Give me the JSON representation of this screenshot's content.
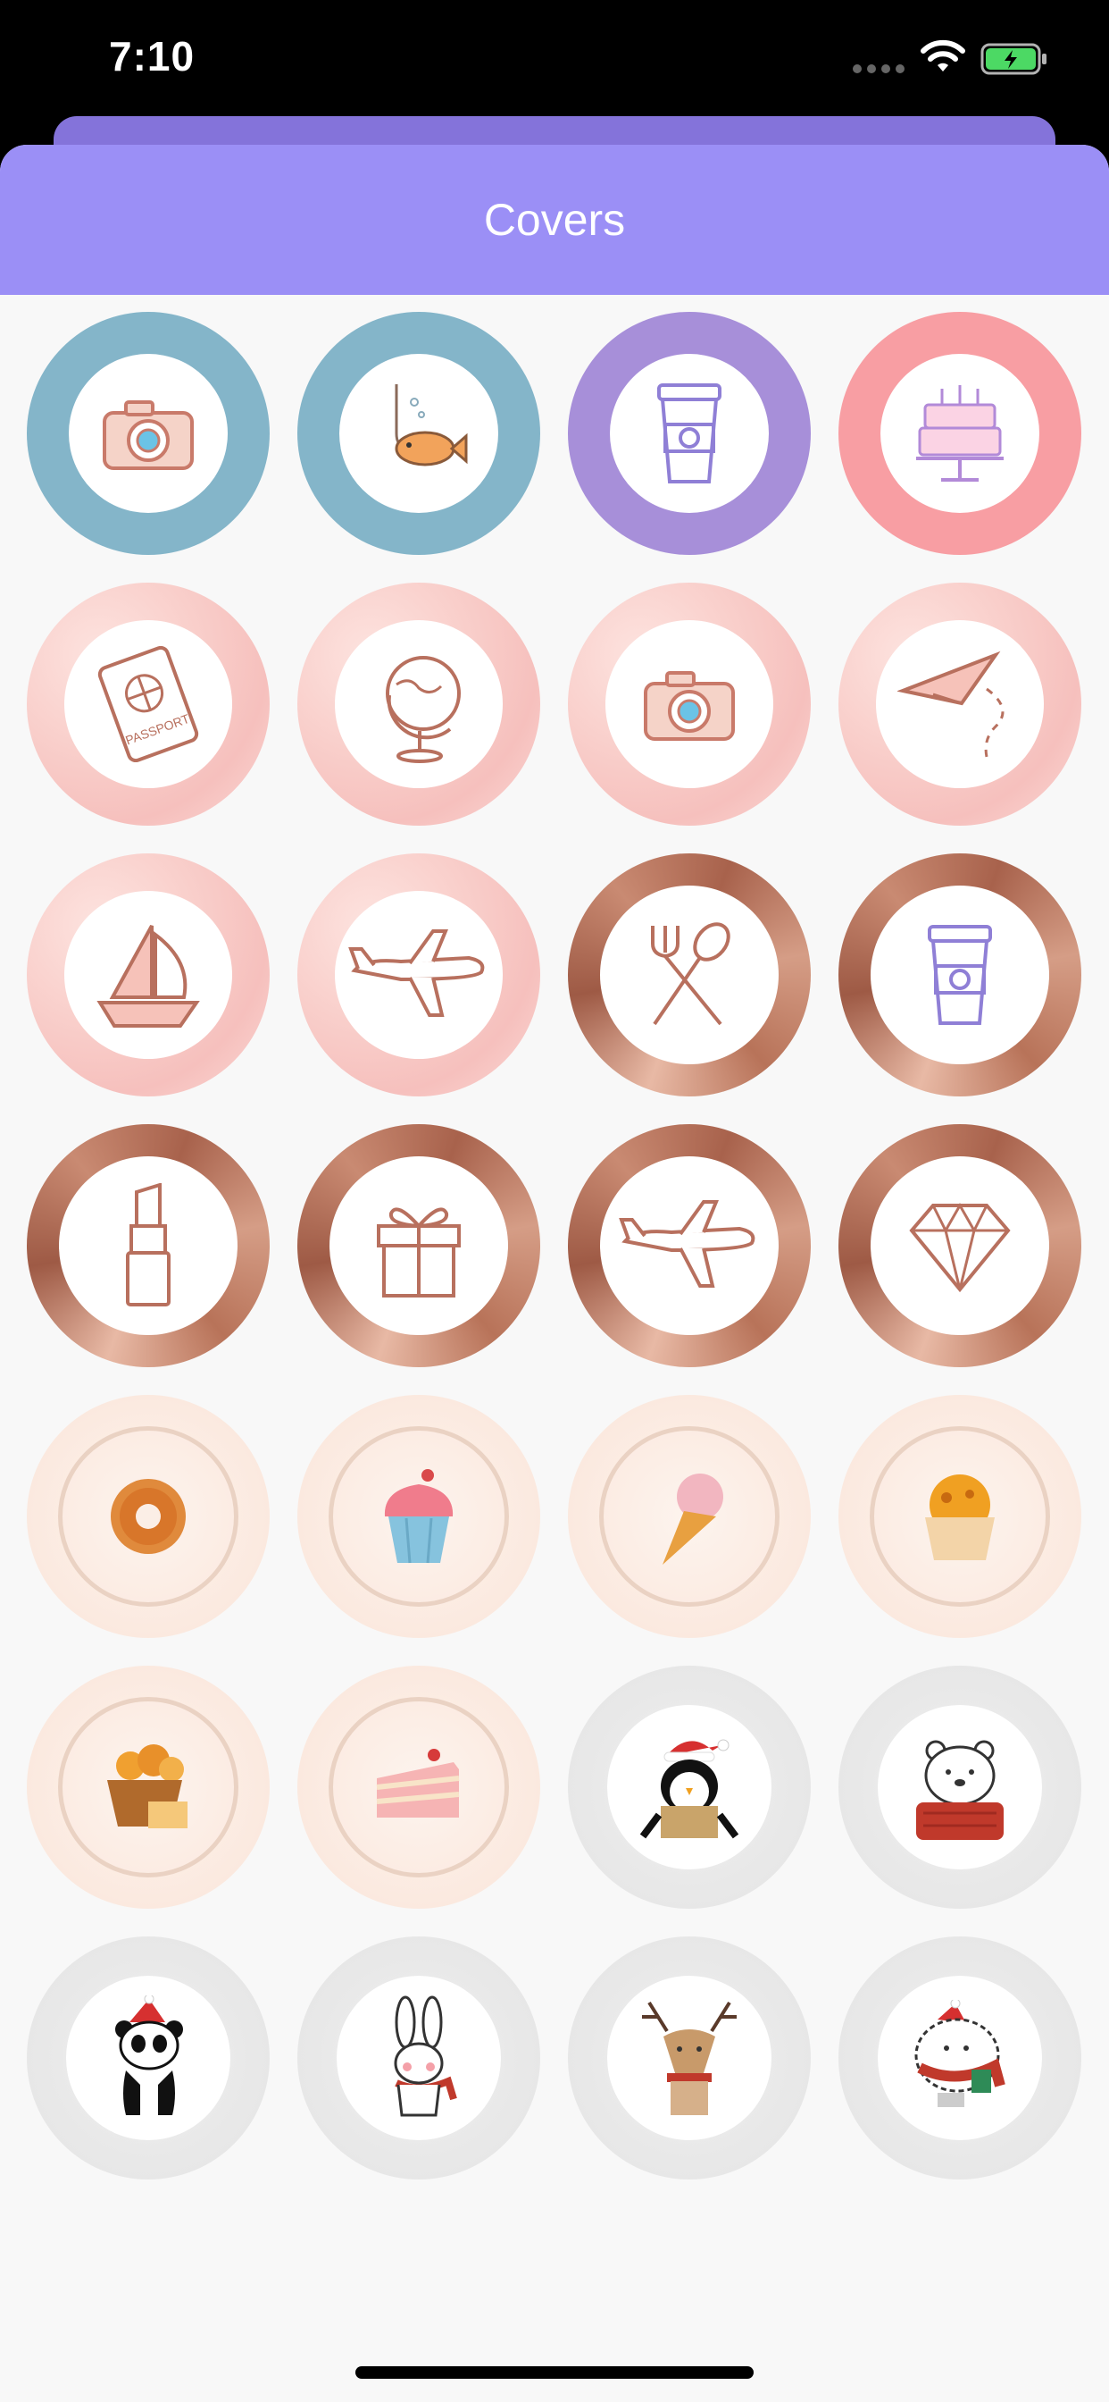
{
  "status_bar": {
    "time": "7:10"
  },
  "nav": {
    "title": "Covers"
  },
  "covers": [
    {
      "icon": "camera-icon",
      "style": "ring-blue"
    },
    {
      "icon": "fish-icon",
      "style": "ring-blue"
    },
    {
      "icon": "coffee-cup-icon",
      "style": "ring-purple"
    },
    {
      "icon": "cake-icon",
      "style": "ring-pink"
    },
    {
      "icon": "passport-icon",
      "style": "marble-pink"
    },
    {
      "icon": "globe-icon",
      "style": "marble-pink"
    },
    {
      "icon": "camera-icon",
      "style": "marble-pink"
    },
    {
      "icon": "paper-plane-icon",
      "style": "marble-pink"
    },
    {
      "icon": "sailboat-icon",
      "style": "marble-pink"
    },
    {
      "icon": "airplane-icon",
      "style": "marble-pink"
    },
    {
      "icon": "fork-spoon-icon",
      "style": "rosegold"
    },
    {
      "icon": "coffee-cup-icon",
      "style": "rosegold"
    },
    {
      "icon": "lipstick-icon",
      "style": "rosegold"
    },
    {
      "icon": "gift-icon",
      "style": "rosegold"
    },
    {
      "icon": "airplane-icon",
      "style": "rosegold"
    },
    {
      "icon": "diamond-icon",
      "style": "rosegold"
    },
    {
      "icon": "donut-icon",
      "style": "cream"
    },
    {
      "icon": "cupcake-icon",
      "style": "cream"
    },
    {
      "icon": "ice-cream-icon",
      "style": "cream"
    },
    {
      "icon": "muffin-icon",
      "style": "cream"
    },
    {
      "icon": "bread-basket-icon",
      "style": "cream"
    },
    {
      "icon": "cake-slice-icon",
      "style": "cream"
    },
    {
      "icon": "penguin-icon",
      "style": "gray"
    },
    {
      "icon": "polar-bear-icon",
      "style": "gray"
    },
    {
      "icon": "panda-icon",
      "style": "gray"
    },
    {
      "icon": "bunny-icon",
      "style": "gray"
    },
    {
      "icon": "reindeer-icon",
      "style": "gray"
    },
    {
      "icon": "hedgehog-icon",
      "style": "gray"
    }
  ]
}
